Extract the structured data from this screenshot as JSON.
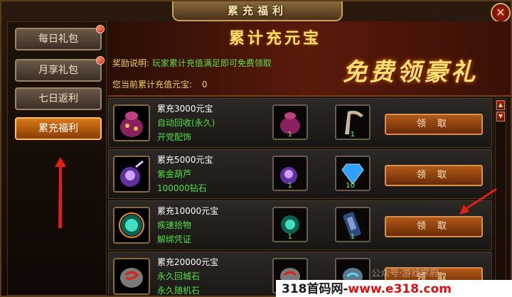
{
  "window": {
    "title": "累充福利"
  },
  "sidebar": {
    "items": [
      {
        "label": "每日礼包",
        "has_badge": true
      },
      {
        "label": "月享礼包",
        "has_badge": true
      },
      {
        "label": "七日返利",
        "has_badge": false
      },
      {
        "label": "累充福利",
        "has_badge": false,
        "active": true
      }
    ]
  },
  "banner": {
    "title": "累计充元宝",
    "reward_label": "奖励说明:",
    "reward_desc": "玩家累计充值满足即可免费领取",
    "current_label": "您当前累计充值元宝:",
    "current_value": "0",
    "promo": "免费领豪礼"
  },
  "rewards": [
    {
      "threshold": "累充3000元宝",
      "line2": "自动回收(永久)",
      "line3": "开党配饰",
      "qty1": "1",
      "qty2": "1",
      "claim": "领 取"
    },
    {
      "threshold": "累充5000元宝",
      "line2": "紫金葫芦",
      "line3": "100000钻石",
      "qty1": "1",
      "qty2": "10",
      "claim": "领 取"
    },
    {
      "threshold": "累充10000元宝",
      "line2": "疾速拾物",
      "line3": "解绑凭证",
      "qty1": "1",
      "qty2": "1",
      "claim": "领 取"
    },
    {
      "threshold": "累充20000元宝",
      "line2": "永久回城石",
      "line3": "永久随机石",
      "qty1": "1",
      "qty2": "1",
      "claim": "领 取"
    }
  ],
  "watermark": {
    "wechat": "公众号·游戏学府",
    "site_prefix": "318首码网-",
    "site_url": "www.e318.com"
  },
  "colors": {
    "accent": "#d87818",
    "green_text": "#50e040",
    "gold_text": "#f0d060"
  }
}
